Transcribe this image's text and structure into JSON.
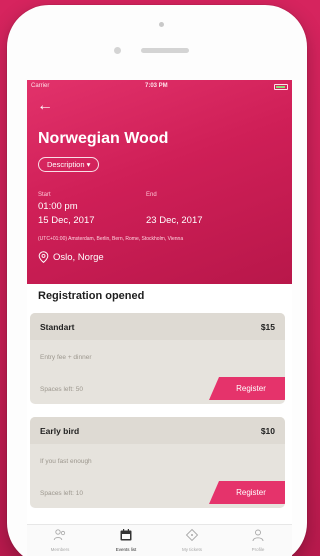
{
  "status_bar": {
    "carrier": "Carrier",
    "time": "7:03 PM"
  },
  "event": {
    "title": "Norwegian Wood",
    "description_button": "Description",
    "start_label": "Start",
    "end_label": "End",
    "start_time": "01:00 pm",
    "start_date": "15 Dec, 2017",
    "end_date": "23 Dec, 2017",
    "timezone": "(UTC+01:00) Amsterdam, Berlin, Bern, Rome, Stockholm, Vienna",
    "location": "Oslo, Norge"
  },
  "registration": {
    "heading": "Registration opened",
    "tickets": [
      {
        "name": "Standart",
        "price": "$15",
        "description": "Entry fee + dinner",
        "spaces": "Spaces left: 50",
        "button": "Register"
      },
      {
        "name": "Early bird",
        "price": "$10",
        "description": "If you fast enough",
        "spaces": "Spaces left: 10",
        "button": "Register"
      }
    ]
  },
  "tabbar": {
    "tabs": [
      {
        "label": "Members",
        "icon": "members-icon",
        "active": false
      },
      {
        "label": "Events list",
        "icon": "calendar-icon",
        "active": true
      },
      {
        "label": "My tickets",
        "icon": "ticket-icon",
        "active": false
      },
      {
        "label": "Profile",
        "icon": "profile-icon",
        "active": false
      }
    ]
  },
  "colors": {
    "accent": "#e5336b",
    "hero": "#cf1f57",
    "ticket_bg": "#e6e3dd"
  }
}
